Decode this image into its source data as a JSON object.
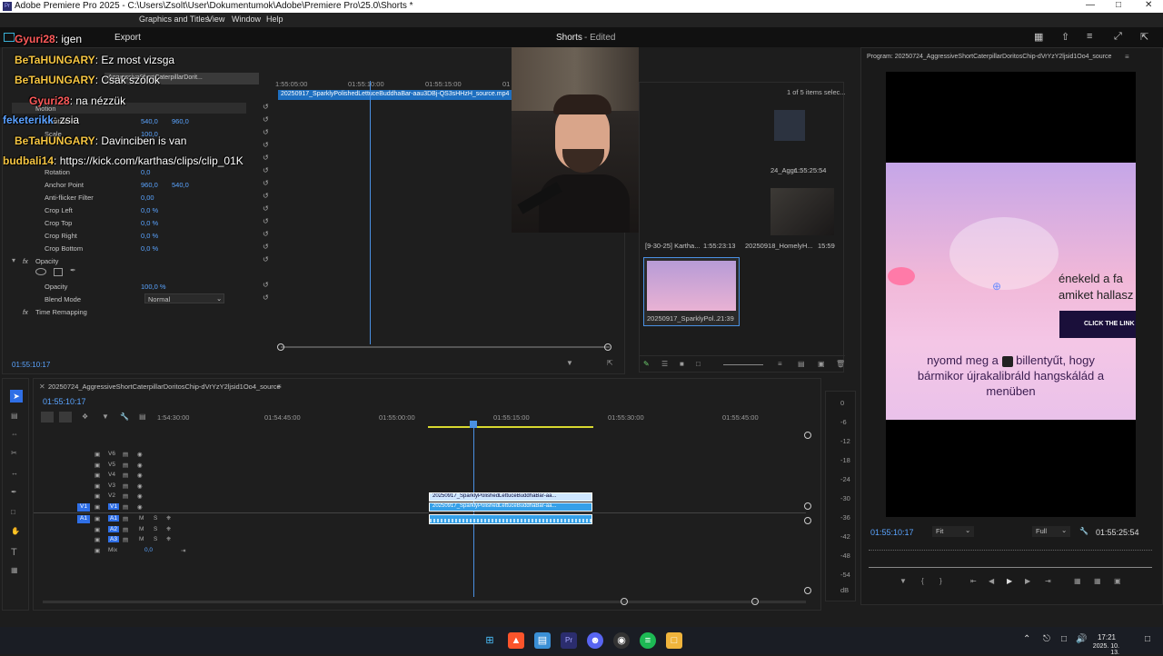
{
  "window": {
    "title": "Adobe Premiere Pro 2025 - C:\\Users\\Zsolt\\User\\Dokumentumok\\Adobe\\Premiere Pro\\25.0\\Shorts *",
    "min_icon": "minimize-icon",
    "max_icon": "maximize-icon",
    "close_icon": "close-icon"
  },
  "menu": [
    "Graphics and Titles",
    "View",
    "Window",
    "Help"
  ],
  "appbar": {
    "export_label": "Export",
    "project_title": "Shorts",
    "project_status": "- Edited"
  },
  "chat": [
    {
      "user": "Gyuri28",
      "user_color": "#ff5a5a",
      "text": "igen"
    },
    {
      "user": "BeTaHUNGARY",
      "user_color": "#f5c542",
      "text": "Ez most vizsga"
    },
    {
      "user": "BeTaHUNGARY",
      "user_color": "#f5c542",
      "text": "Csak szólok"
    },
    {
      "user": "Gyuri28",
      "user_color": "#ff5a5a",
      "text": "na nézzük"
    },
    {
      "user": "feketerikk",
      "user_color": "#5aa0ff",
      "text": "zsia"
    },
    {
      "user": "BeTaHUNGARY",
      "user_color": "#f5c542",
      "text": "Davinciben is van"
    },
    {
      "user": "budbali14",
      "user_color": "#f5c542",
      "text": "https://kick.com/karthas/clips/clip_01K"
    }
  ],
  "effect_controls": {
    "source_name": "AggressiveShortCaterpillarDorit...",
    "ruler": [
      "1:55:05:00",
      "01:55:10:00",
      "01:55:15:00",
      "01"
    ],
    "clip_name": "20250917_SparklyPolishedLettuceBuddhaBar-aau3DBj-QS3sHHzH_source.mp4",
    "section_motion": "Motion",
    "rows": [
      {
        "label": "Position",
        "v1": "540,0",
        "v2": "960,0"
      },
      {
        "label": "Scale",
        "v1": "100,0",
        "v2": ""
      },
      {
        "label": "Rotation",
        "v1": "0,0",
        "v2": ""
      },
      {
        "label": "Anchor Point",
        "v1": "960,0",
        "v2": "540,0"
      },
      {
        "label": "Anti-flicker Filter",
        "v1": "0,00",
        "v2": ""
      },
      {
        "label": "Crop Left",
        "v1": "0,0 %",
        "v2": ""
      },
      {
        "label": "Crop Top",
        "v1": "0,0 %",
        "v2": ""
      },
      {
        "label": "Crop Right",
        "v1": "0,0 %",
        "v2": ""
      },
      {
        "label": "Crop Bottom",
        "v1": "0,0 %",
        "v2": ""
      }
    ],
    "section_opacity": "Opacity",
    "opacity_label": "Opacity",
    "opacity_value": "100,0 %",
    "blend_label": "Blend Mode",
    "blend_value": "Normal",
    "time_remap": "Time Remapping",
    "timecode": "01:55:10:17"
  },
  "project_bin": {
    "selected": "1 of 5 items selec...",
    "items": [
      {
        "name": "24_Aggr...",
        "duration": "1:55:25:54"
      },
      {
        "name": "[9-30-25] Kartha...",
        "duration": "1:55:23:13"
      },
      {
        "name": "20250918_HomelyH...",
        "duration": "15:59"
      },
      {
        "name": "20250917_SparklyPol...",
        "duration": "21:39"
      }
    ]
  },
  "program": {
    "title": "Program: 20250724_AggressiveShortCaterpillarDoritosChip-dVrYzY2ljsid1Oo4_source",
    "overlay_right1": "énekeld a fa",
    "overlay_right2": "amiket hallasz",
    "click_link": "CLICK THE LINK",
    "caption_line1a": "nyomd meg a",
    "caption_line1b": "billentyűt, hogy",
    "caption_line2": "bármikor újrakalibráld hangskálád a",
    "caption_line3": "menüben",
    "timecode": "01:55:10:17",
    "fit": "Fit",
    "quality": "Full",
    "duration": "01:55:25:54"
  },
  "timeline": {
    "sequence_name": "20250724_AggressiveShortCaterpillarDoritosChip-dVrYzY2ljsid1Oo4_source",
    "timecode": "01:55:10:17",
    "ruler": [
      "1:54:30:00",
      "01:54:45:00",
      "01:55:00:00",
      "01:55:15:00",
      "01:55:30:00",
      "01:55:45:00"
    ],
    "video_tracks": [
      "V6",
      "V5",
      "V4",
      "V3",
      "V2",
      "V1"
    ],
    "audio_tracks": [
      "A1",
      "A2",
      "A3"
    ],
    "mix_label": "Mix",
    "mix_value": "0,0",
    "clip_top": "20250917_SparklyPolishedLettuceBuddhaBar-aa...",
    "clip_v1": "20250917_SparklyPolishedLettuceBuddhaBar-aa...",
    "meter": [
      "0",
      "-6",
      "-12",
      "-18",
      "-24",
      "-30",
      "-36",
      "-42",
      "-48",
      "-54",
      "dB"
    ]
  },
  "taskbar": {
    "time": "17:21",
    "date": "2025. 10. 13."
  }
}
